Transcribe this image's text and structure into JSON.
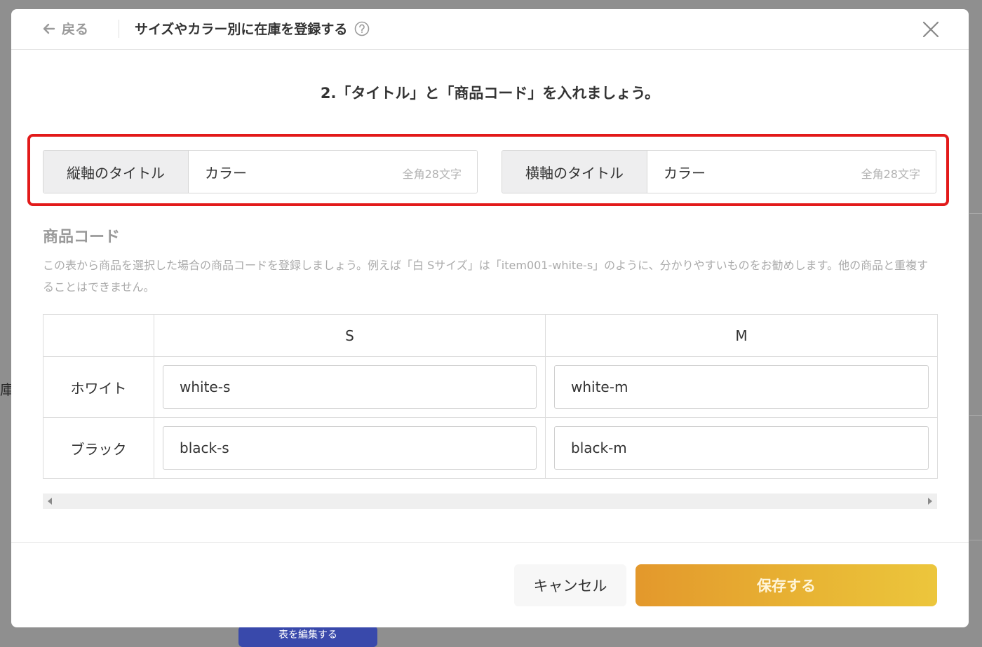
{
  "background": {
    "side_char": "庫",
    "edit_button_label": "表を編集する"
  },
  "header": {
    "back_label": "戻る",
    "title": "サイズやカラー別に在庫を登録する"
  },
  "step_text": "2.「タイトル」と「商品コード」を入れましょう。",
  "title_fields": {
    "vertical": {
      "label": "縦軸のタイトル",
      "value": "カラー",
      "limit": "全角28文字"
    },
    "horizontal": {
      "label": "横軸のタイトル",
      "value": "カラー",
      "limit": "全角28文字"
    }
  },
  "product_code": {
    "title": "商品コード",
    "description": "この表から商品を選択した場合の商品コードを登録しましょう。例えば「白 Sサイズ」は「item001-white-s」のように、分かりやすいものをお勧めします。他の商品と重複することはできません。"
  },
  "table": {
    "columns": [
      "S",
      "M"
    ],
    "rows": [
      {
        "label": "ホワイト",
        "codes": [
          "white-s",
          "white-m"
        ]
      },
      {
        "label": "ブラック",
        "codes": [
          "black-s",
          "black-m"
        ]
      }
    ]
  },
  "footer": {
    "cancel_label": "キャンセル",
    "save_label": "保存する"
  },
  "colors": {
    "highlight": "#e21a1a",
    "save_gradient_start": "#e3982c",
    "save_gradient_end": "#ecc63c"
  }
}
